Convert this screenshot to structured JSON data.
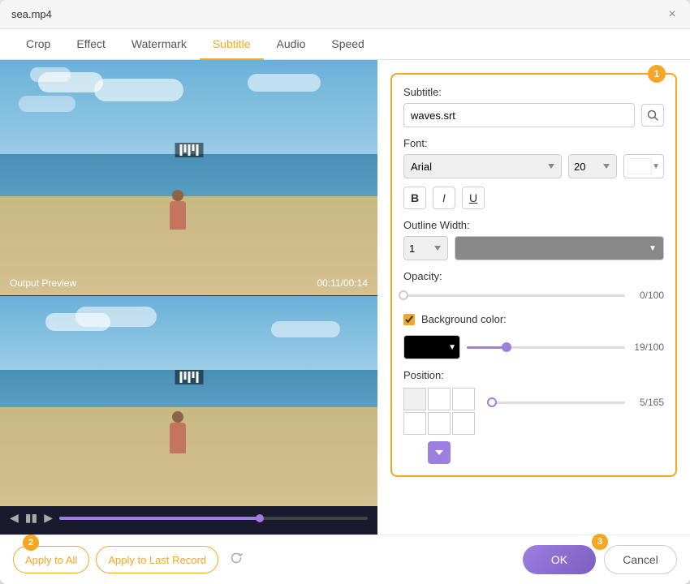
{
  "window": {
    "title": "sea.mp4",
    "close_label": "×"
  },
  "tabs": {
    "items": [
      {
        "label": "Crop"
      },
      {
        "label": "Effect"
      },
      {
        "label": "Watermark"
      },
      {
        "label": "Subtitle"
      },
      {
        "label": "Audio"
      },
      {
        "label": "Speed"
      }
    ],
    "active": "Subtitle"
  },
  "preview": {
    "label": "Output Preview",
    "time": "00:11/00:14"
  },
  "subtitle": {
    "section_label": "Subtitle:",
    "file": "waves.srt",
    "badge1": "1",
    "font_label": "Font:",
    "font_name": "Arial",
    "font_size": "20",
    "bold_label": "B",
    "italic_label": "I",
    "underline_label": "U",
    "outline_label": "Outline Width:",
    "outline_value": "1",
    "opacity_label": "Opacity:",
    "opacity_value": "0/100",
    "bg_color_label": "Background color:",
    "bg_opacity_value": "19/100",
    "position_label": "Position:",
    "position_value": "5/165"
  },
  "actions": {
    "badge2": "2",
    "badge3": "3",
    "apply_all": "Apply to All",
    "apply_last": "Apply to Last Record",
    "ok": "OK",
    "cancel": "Cancel"
  }
}
